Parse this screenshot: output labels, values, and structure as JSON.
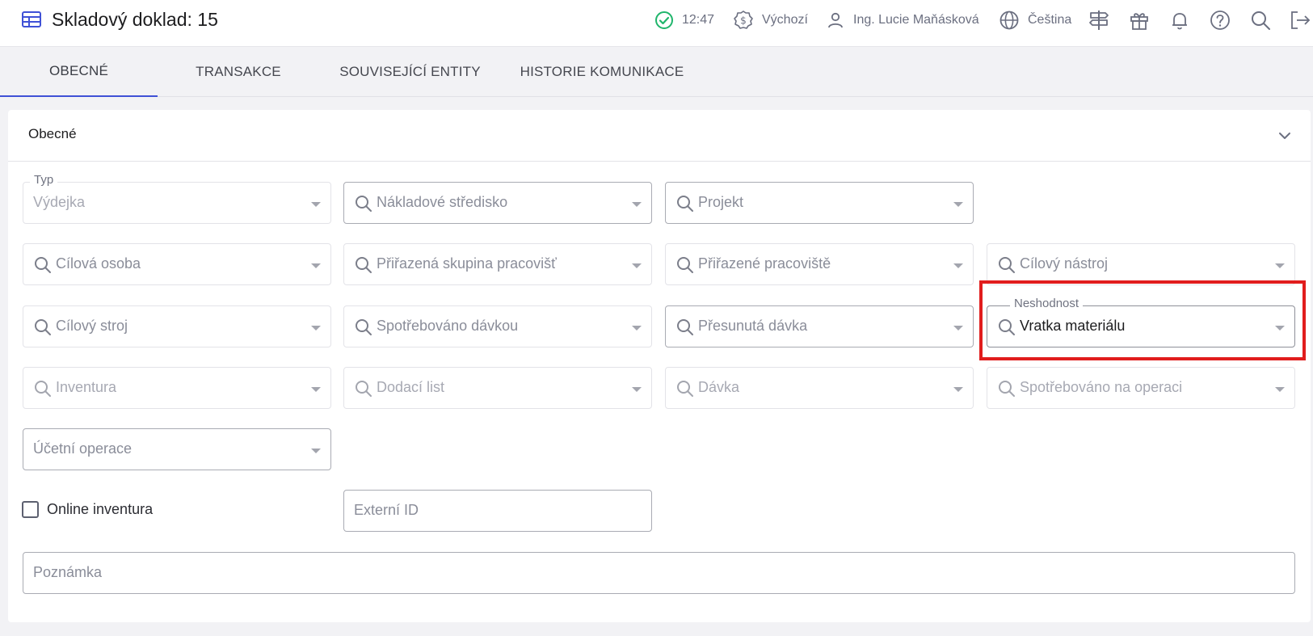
{
  "header": {
    "title": "Skladový doklad: 15",
    "time": "12:47",
    "currency": "Výchozí",
    "user": "Ing. Lucie Maňásková",
    "language": "Čeština",
    "icons": [
      "table-icon",
      "check-circle-icon",
      "currency-icon",
      "user-icon",
      "globe-icon",
      "signpost-icon",
      "gift-icon",
      "bell-icon",
      "help-icon",
      "search-icon",
      "logout-icon"
    ]
  },
  "tabs": [
    {
      "label": "OBECNÉ",
      "active": true
    },
    {
      "label": "TRANSAKCE",
      "active": false
    },
    {
      "label": "SOUVISEJÍCÍ ENTITY",
      "active": false
    },
    {
      "label": "HISTORIE KOMUNIKACE",
      "active": false
    }
  ],
  "section": {
    "title": "Obecné"
  },
  "fields": {
    "typ": {
      "legend": "Typ",
      "value": "Výdejka"
    },
    "nakladove_stredisko": {
      "placeholder": "Nákladové středisko"
    },
    "projekt": {
      "placeholder": "Projekt"
    },
    "cilova_osoba": {
      "placeholder": "Cílová osoba"
    },
    "prirazena_skupina": {
      "placeholder": "Přiřazená skupina pracovišť"
    },
    "prirazene_pracoviste": {
      "placeholder": "Přiřazené pracoviště"
    },
    "cilovy_nastroj": {
      "placeholder": "Cílový nástroj"
    },
    "cilovy_stroj": {
      "placeholder": "Cílový stroj"
    },
    "spotrebovano_davkou": {
      "placeholder": "Spotřebováno dávkou"
    },
    "presunuta_davka": {
      "placeholder": "Přesunutá dávka"
    },
    "neshodnost": {
      "legend": "Neshodnost",
      "value": "Vratka materiálu"
    },
    "inventura": {
      "placeholder": "Inventura"
    },
    "dodaci_list": {
      "placeholder": "Dodací list"
    },
    "davka": {
      "placeholder": "Dávka"
    },
    "spotrebovano_na_operaci": {
      "placeholder": "Spotřebováno na operaci"
    },
    "ucetni_operace": {
      "placeholder": "Účetní operace"
    },
    "online_inventura": {
      "label": "Online inventura",
      "checked": false
    },
    "externi_id": {
      "placeholder": "Externí ID"
    },
    "poznamka": {
      "placeholder": "Poznámka"
    }
  },
  "colors": {
    "accent": "#3f51d6",
    "status_ok": "#1fb56b",
    "highlight": "#e11d1d"
  }
}
